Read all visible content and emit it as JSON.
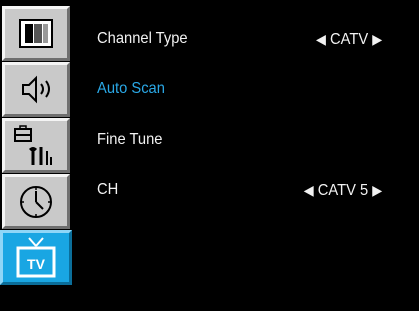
{
  "sidebar": {
    "tabs": [
      {
        "icon": "picture-icon",
        "active": false
      },
      {
        "icon": "sound-icon",
        "active": false
      },
      {
        "icon": "setup-icon",
        "active": false
      },
      {
        "icon": "clock-icon",
        "active": false
      },
      {
        "icon": "tv-icon",
        "label": "TV",
        "active": true
      }
    ]
  },
  "menu": {
    "items": [
      {
        "label": "Channel Type",
        "value": "CATV",
        "left_arrow": "◀",
        "right_arrow": "▶"
      },
      {
        "label": "Auto Scan",
        "selected": true
      },
      {
        "label": "Fine Tune"
      },
      {
        "label": "CH",
        "value": "CATV 5",
        "left_arrow": "◀",
        "right_arrow": "▶"
      }
    ]
  },
  "colors": {
    "background": "#000000",
    "text": "#f2f2f2",
    "highlight_text": "#2aa8e6",
    "active_tab": "#19a6e3",
    "inactive_tab": "#c9c9c9"
  }
}
